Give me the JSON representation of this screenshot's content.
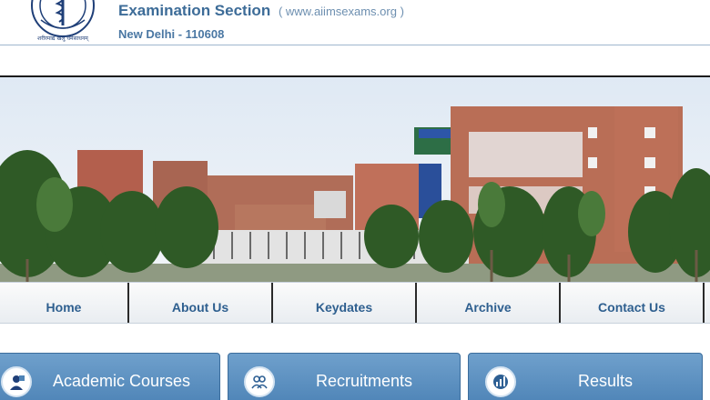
{
  "header": {
    "title": "Examination Section",
    "url": "( www.aiimsexams.org )",
    "address": "New Delhi - 110608",
    "logo_text": "अखिल भारतीय आयुर्विज्ञान संस्थान"
  },
  "nav": {
    "items": [
      {
        "label": "Home"
      },
      {
        "label": "About Us"
      },
      {
        "label": "Keydates"
      },
      {
        "label": "Archive"
      },
      {
        "label": "Contact Us"
      }
    ]
  },
  "tiles": [
    {
      "label": "Academic Courses",
      "icon": "graduate-icon"
    },
    {
      "label": "Recruitments",
      "icon": "people-icon"
    },
    {
      "label": "Results",
      "icon": "chart-icon"
    }
  ],
  "colors": {
    "header_text": "#3d6c98",
    "nav_text": "#2e5f8f",
    "tile_bg": "#5b8fc1"
  }
}
